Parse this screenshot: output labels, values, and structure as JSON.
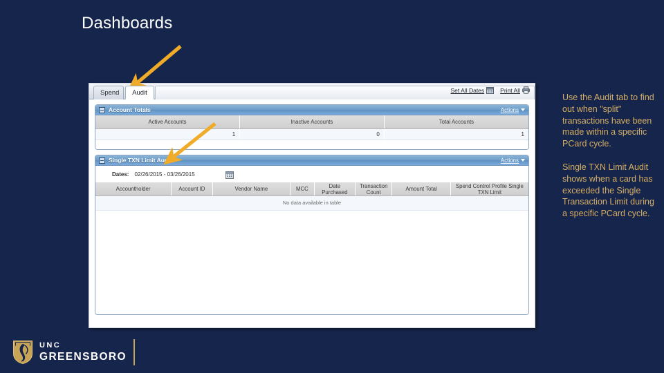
{
  "slide": {
    "title": "Dashboards",
    "background_color": "#16254b",
    "note_color": "#d5ae62"
  },
  "notes": [
    "Use the Audit tab to find out when \"split\" transactions have been made within a specific PCard cycle.",
    "Single TXN Limit Audit shows when a card has exceeded the Single Transaction Limit during a specific PCard cycle."
  ],
  "app": {
    "tabs": [
      {
        "label": "Spend",
        "active": false
      },
      {
        "label": "Audit",
        "active": true
      }
    ],
    "toolbar": [
      {
        "label": "Set All Dates",
        "icon": "calendar-icon"
      },
      {
        "label": "Print All",
        "icon": "printer-icon"
      }
    ],
    "panels": [
      {
        "title": "Account Totals",
        "actions_label": "Actions",
        "actions_icon": "caret-down-icon",
        "collapse_icon": "collapse-minus-icon",
        "columns": [
          "Active Accounts",
          "Inactive Accounts",
          "Total Accounts"
        ],
        "rows": [
          [
            "1",
            "0",
            "1"
          ]
        ]
      },
      {
        "title": "Single TXN Limit Audit",
        "actions_label": "Actions",
        "actions_icon": "caret-down-icon",
        "collapse_icon": "collapse-minus-icon",
        "dates_label": "Dates:",
        "dates_value": "02/26/2015 - 03/26/2015",
        "calendar_icon": "calendar-icon",
        "columns": [
          "Accountholder",
          "Account ID",
          "Vendor Name",
          "MCC",
          "Date Purchased",
          "Transaction Count",
          "Amount Total",
          "Spend Control Profile Single TXN Limit"
        ],
        "empty_message": "No data available in table"
      }
    ]
  },
  "annotations": [
    {
      "name": "arrow-to-audit-tab",
      "target": "Audit tab",
      "color": "#f0ab28"
    },
    {
      "name": "arrow-to-txn-panel",
      "target": "Single TXN Limit Audit panel",
      "color": "#f0ab28"
    }
  ],
  "logo": {
    "line1": "UNC",
    "line2": "GREENSBORO",
    "icon": "uncg-shield-icon",
    "gold": "#c8a456"
  }
}
